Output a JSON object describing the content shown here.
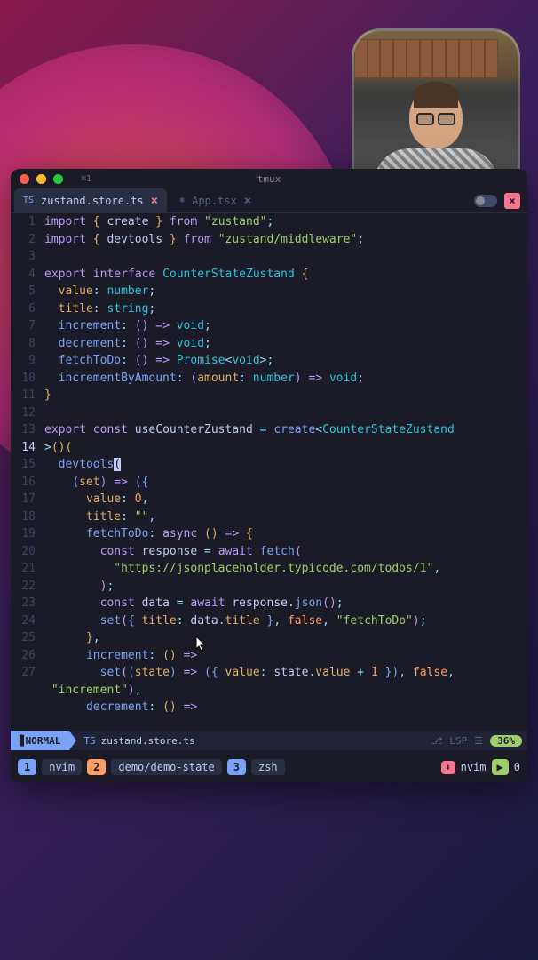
{
  "titlebar": {
    "left": "⌘1",
    "center": "tmux"
  },
  "tabs": {
    "active": {
      "icon": "TS",
      "label": "zustand.store.ts",
      "close": "×"
    },
    "inactive": {
      "icon": "⚛",
      "label": "App.tsx",
      "close": "×"
    }
  },
  "code": {
    "lines": [
      {
        "n": 1
      },
      {
        "n": 2
      },
      {
        "n": 3
      },
      {
        "n": 4
      },
      {
        "n": 5
      },
      {
        "n": 6
      },
      {
        "n": 7
      },
      {
        "n": 8
      },
      {
        "n": 9
      },
      {
        "n": 10
      },
      {
        "n": 11
      },
      {
        "n": 12
      },
      {
        "n": 13
      },
      {
        "n": 14
      },
      {
        "n": 15
      },
      {
        "n": 16
      },
      {
        "n": 17
      },
      {
        "n": 18
      },
      {
        "n": 19
      },
      {
        "n": 20
      },
      {
        "n": 21
      },
      {
        "n": 22
      },
      {
        "n": 23
      },
      {
        "n": 24
      },
      {
        "n": 25
      },
      {
        "n": 26
      },
      {
        "n": 27
      }
    ],
    "l1_kw1": "import",
    "l1_kw2": "from",
    "l1_id": "create",
    "l1_str": "\"zustand\"",
    "l2_kw1": "import",
    "l2_kw2": "from",
    "l2_id": "devtools",
    "l2_str": "\"zustand/middleware\"",
    "l4_kw1": "export",
    "l4_kw2": "interface",
    "l4_id": "CounterStateZustand",
    "l5_p": "value",
    "l5_t": "number",
    "l6_p": "title",
    "l6_t": "string",
    "l7_p": "increment",
    "l7_t": "void",
    "l8_p": "decrement",
    "l8_t": "void",
    "l9_p": "fetchToDo",
    "l9_t": "Promise",
    "l9_t2": "void",
    "l10_p": "incrementByAmount",
    "l10_arg": "amount",
    "l10_t1": "number",
    "l10_t2": "void",
    "l13_kw1": "export",
    "l13_kw2": "const",
    "l13_id": "useCounterZustand",
    "l13_fn": "create",
    "l13_t": "CounterStateZustand",
    "l14_fn": "devtools",
    "l15_arg": "set",
    "l16_p": "value",
    "l16_v": "0",
    "l17_p": "title",
    "l17_v": "\"\"",
    "l18_p": "fetchToDo",
    "l18_kw": "async",
    "l19_kw": "const",
    "l19_id": "response",
    "l19_kw2": "await",
    "l19_fn": "fetch",
    "l20_str": "\"https://jsonplaceholder.typicode.com/todos/1\"",
    "l22_kw": "const",
    "l22_id": "data",
    "l22_kw2": "await",
    "l22_obj": "response",
    "l22_fn": "json",
    "l23_fn": "set",
    "l23_p": "title",
    "l23_obj": "data",
    "l23_prop": "title",
    "l23_bool": "false",
    "l23_str": "\"fetchToDo\"",
    "l25_p": "increment",
    "l26_fn": "set",
    "l26_arg": "state",
    "l26_p": "value",
    "l26_obj": "state",
    "l26_prop": "value",
    "l26_num": "1",
    "l26_bool": "false",
    "l26b_str": "\"increment\"",
    "l27_p": "decrement"
  },
  "status": {
    "mode": "NORMAL",
    "file_icon": "TS",
    "file": "zustand.store.ts",
    "git_icon": "⎇",
    "lsp": "LSP",
    "percent": "36%"
  },
  "tmux": {
    "w1_n": "1",
    "w1_l": "nvim",
    "w2_n": "2",
    "w2_l": "demo/demo-state",
    "w3_n": "3",
    "w3_l": "zsh",
    "right_icon": "⇞",
    "right_label": "nvim",
    "right_ind": "▶",
    "right_num": "0"
  }
}
